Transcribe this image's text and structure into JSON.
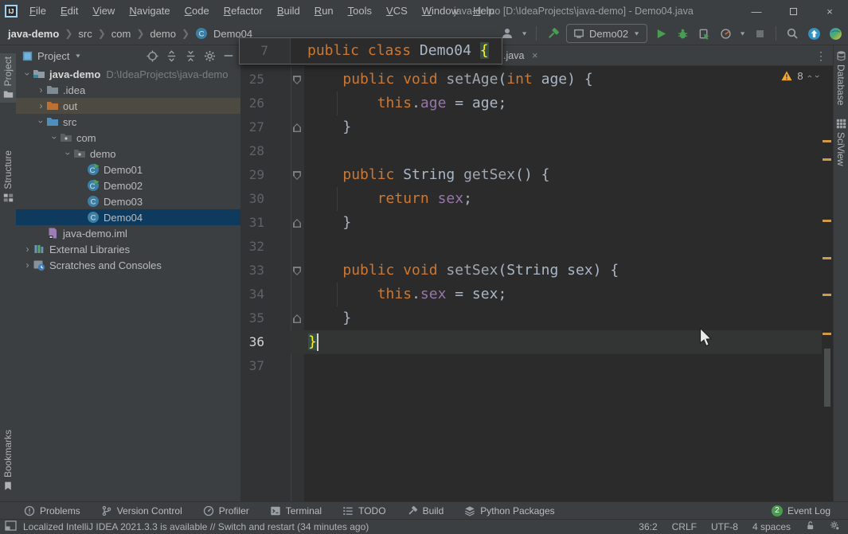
{
  "window": {
    "title": "java-demo [D:\\IdeaProjects\\java-demo] - Demo04.java"
  },
  "menu": {
    "items": [
      "File",
      "Edit",
      "View",
      "Navigate",
      "Code",
      "Refactor",
      "Build",
      "Run",
      "Tools",
      "VCS",
      "Window",
      "Help"
    ]
  },
  "breadcrumbs": {
    "items": [
      "java-demo",
      "src",
      "com",
      "demo",
      "Demo04"
    ]
  },
  "toolbar": {
    "run_config": "Demo02"
  },
  "left_stripe": {
    "items": [
      {
        "label": "Project"
      },
      {
        "label": "Structure"
      },
      {
        "label": "Bookmarks"
      }
    ]
  },
  "right_stripe": {
    "items": [
      {
        "label": "Database"
      },
      {
        "label": "SciView"
      }
    ]
  },
  "project": {
    "header": {
      "title": "Project"
    },
    "tree": [
      {
        "indent": 0,
        "chevron": "open",
        "icon": "folder-project",
        "label": "java-demo",
        "bold": true,
        "suffix": "D:\\IdeaProjects\\java-demo"
      },
      {
        "indent": 1,
        "chevron": "closed",
        "icon": "folder-plain",
        "label": ".idea"
      },
      {
        "indent": 1,
        "chevron": "closed",
        "icon": "folder-out",
        "label": "out",
        "state": "hover"
      },
      {
        "indent": 1,
        "chevron": "open",
        "icon": "folder-src",
        "label": "src"
      },
      {
        "indent": 2,
        "chevron": "open",
        "icon": "package",
        "label": "com"
      },
      {
        "indent": 3,
        "chevron": "open",
        "icon": "package",
        "label": "demo"
      },
      {
        "indent": 4,
        "chevron": null,
        "icon": "class-run",
        "label": "Demo01"
      },
      {
        "indent": 4,
        "chevron": null,
        "icon": "class-run",
        "label": "Demo02"
      },
      {
        "indent": 4,
        "chevron": null,
        "icon": "class",
        "label": "Demo03"
      },
      {
        "indent": 4,
        "chevron": null,
        "icon": "class",
        "label": "Demo04",
        "state": "selected"
      },
      {
        "indent": 1,
        "chevron": null,
        "icon": "iml",
        "label": "java-demo.iml"
      },
      {
        "indent": 0,
        "chevron": "closed",
        "icon": "library",
        "label": "External Libraries"
      },
      {
        "indent": 0,
        "chevron": "closed",
        "icon": "scratches",
        "label": "Scratches and Consoles"
      }
    ]
  },
  "editor": {
    "tab": {
      "label": ".java",
      "close": "×",
      "more": "⋮"
    },
    "sticky": {
      "num": "7",
      "segments": [
        [
          "kw",
          "public class "
        ],
        [
          "txt",
          "Demo04 "
        ],
        [
          "brace",
          "{"
        ]
      ]
    },
    "inspections": {
      "count": "8"
    },
    "lines": [
      {
        "num": "25",
        "fold": "start",
        "segments": [
          [
            "txt",
            "    "
          ],
          [
            "kw",
            "public void "
          ],
          [
            "meth",
            "setAge"
          ],
          [
            "txt",
            "("
          ],
          [
            "kw",
            "int"
          ],
          [
            "txt",
            " age) {"
          ]
        ]
      },
      {
        "num": "26",
        "guide": true,
        "segments": [
          [
            "txt",
            "        "
          ],
          [
            "kw",
            "this"
          ],
          [
            "txt",
            "."
          ],
          [
            "fld",
            "age"
          ],
          [
            "txt",
            " = age;"
          ]
        ]
      },
      {
        "num": "27",
        "fold": "end",
        "segments": [
          [
            "txt",
            "    }"
          ]
        ]
      },
      {
        "num": "28",
        "segments": []
      },
      {
        "num": "29",
        "fold": "start",
        "segments": [
          [
            "txt",
            "    "
          ],
          [
            "kw",
            "public "
          ],
          [
            "txt",
            "String "
          ],
          [
            "meth",
            "getSex"
          ],
          [
            "txt",
            "() {"
          ]
        ]
      },
      {
        "num": "30",
        "guide": true,
        "segments": [
          [
            "txt",
            "        "
          ],
          [
            "kw",
            "return "
          ],
          [
            "fld",
            "sex"
          ],
          [
            "txt",
            ";"
          ]
        ]
      },
      {
        "num": "31",
        "fold": "end",
        "segments": [
          [
            "txt",
            "    }"
          ]
        ]
      },
      {
        "num": "32",
        "segments": []
      },
      {
        "num": "33",
        "fold": "start",
        "segments": [
          [
            "txt",
            "    "
          ],
          [
            "kw",
            "public void "
          ],
          [
            "meth",
            "setSex"
          ],
          [
            "txt",
            "(String sex) {"
          ]
        ]
      },
      {
        "num": "34",
        "guide": true,
        "segments": [
          [
            "txt",
            "        "
          ],
          [
            "kw",
            "this"
          ],
          [
            "txt",
            "."
          ],
          [
            "fld",
            "sex"
          ],
          [
            "txt",
            " = sex;"
          ]
        ]
      },
      {
        "num": "35",
        "fold": "end",
        "segments": [
          [
            "txt",
            "    }"
          ]
        ]
      },
      {
        "num": "36",
        "current": true,
        "caret": true,
        "segments": [
          [
            "brace",
            "}"
          ]
        ]
      },
      {
        "num": "37",
        "segments": []
      }
    ]
  },
  "bottom_bar": {
    "items": [
      {
        "label": "Problems",
        "icon": "problems"
      },
      {
        "label": "Version Control",
        "icon": "branch"
      },
      {
        "label": "Profiler",
        "icon": "gauge"
      },
      {
        "label": "Terminal",
        "icon": "terminal"
      },
      {
        "label": "TODO",
        "icon": "todo"
      },
      {
        "label": "Build",
        "icon": "hammer-gray"
      },
      {
        "label": "Python Packages",
        "icon": "layers"
      }
    ],
    "event_log": {
      "label": "Event Log",
      "badge": "2"
    }
  },
  "status_bar": {
    "message": "Localized IntelliJ IDEA 2021.3.3 is available // Switch and restart (34 minutes ago)",
    "caret_pos": "36:2",
    "line_ending": "CRLF",
    "encoding": "UTF-8",
    "indent": "4 spaces"
  },
  "colors": {
    "keyword": "#cc7832",
    "field": "#9876aa",
    "text": "#a9b7c6",
    "brace": "#ffef28",
    "selection": "#0e3a5e",
    "stripe_mark": "#d29b43",
    "run_green": "#499c54",
    "warning": "#f0a732"
  }
}
